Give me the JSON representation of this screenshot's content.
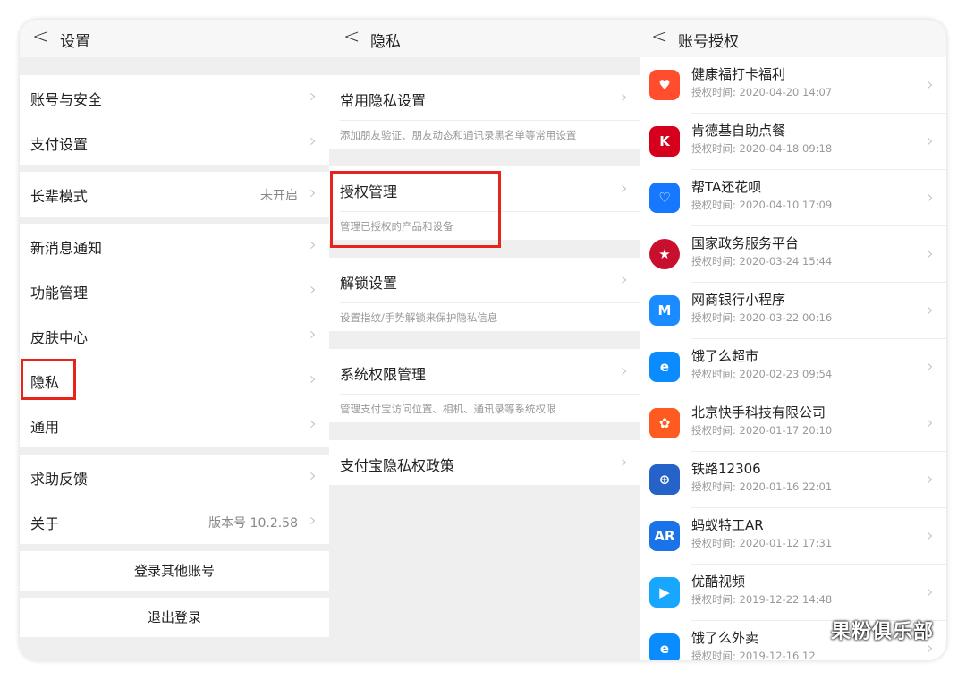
{
  "settings": {
    "title": "设置",
    "items": [
      {
        "label": "账号与安全"
      },
      {
        "label": "支付设置"
      },
      {
        "label": "长辈模式",
        "value": "未开启"
      },
      {
        "label": "新消息通知"
      },
      {
        "label": "功能管理"
      },
      {
        "label": "皮肤中心"
      },
      {
        "label": "隐私"
      },
      {
        "label": "通用"
      },
      {
        "label": "求助反馈"
      },
      {
        "label": "关于",
        "value": "版本号 10.2.58"
      }
    ],
    "login_other": "登录其他账号",
    "logout": "退出登录"
  },
  "privacy": {
    "title": "隐私",
    "items": [
      {
        "label": "常用隐私设置",
        "desc": "添加朋友验证、朋友动态和通讯录黑名单等常用设置"
      },
      {
        "label": "授权管理",
        "desc": "管理已授权的产品和设备"
      },
      {
        "label": "解锁设置",
        "desc": "设置指纹/手势解锁来保护隐私信息"
      },
      {
        "label": "系统权限管理",
        "desc": "管理支付宝访问位置、相机、通讯录等系统权限"
      },
      {
        "label": "支付宝隐私权政策"
      }
    ]
  },
  "auth": {
    "title": "账号授权",
    "apps": [
      {
        "name": "健康福打卡福利",
        "date": "授权时间: 2020-04-20 14:07",
        "icon": "health-gift-icon",
        "color": "#ff4d2d"
      },
      {
        "name": "肯德基自助点餐",
        "date": "授权时间: 2020-04-18 09:18",
        "icon": "kfc-icon",
        "color": "#d6001c"
      },
      {
        "name": "帮TA还花呗",
        "date": "授权时间: 2020-04-10 17:09",
        "icon": "huabei-icon",
        "color": "#1677ff"
      },
      {
        "name": "国家政务服务平台",
        "date": "授权时间: 2020-03-24 15:44",
        "icon": "national-emblem-icon",
        "color": "#c8102e"
      },
      {
        "name": "网商银行小程序",
        "date": "授权时间: 2020-03-22 00:16",
        "icon": "mybank-icon",
        "color": "#1a8cff"
      },
      {
        "name": "饿了么超市",
        "date": "授权时间: 2020-02-23 09:54",
        "icon": "eleme-icon",
        "color": "#0a8cff"
      },
      {
        "name": "北京快手科技有限公司",
        "date": "授权时间: 2020-01-17 20:10",
        "icon": "kuaishou-icon",
        "color": "#ff5a1f"
      },
      {
        "name": "铁路12306",
        "date": "授权时间: 2020-01-16 22:01",
        "icon": "railway-icon",
        "color": "#2563c9"
      },
      {
        "name": "蚂蚁特工AR",
        "date": "授权时间: 2020-01-12 17:31",
        "icon": "ant-agent-icon",
        "color": "#1a73e8"
      },
      {
        "name": "优酷视频",
        "date": "授权时间: 2019-12-22 14:48",
        "icon": "youku-icon",
        "color": "#19a6ff"
      },
      {
        "name": "饿了么外卖",
        "date": "授权时间: 2019-12-16 12",
        "icon": "eleme-icon",
        "color": "#0a8cff"
      }
    ]
  },
  "icons": {
    "back": "chevron-left-icon",
    "row": "chevron-right-icon"
  },
  "highlight_color": "#e8231b",
  "watermark": "果粉俱乐部"
}
